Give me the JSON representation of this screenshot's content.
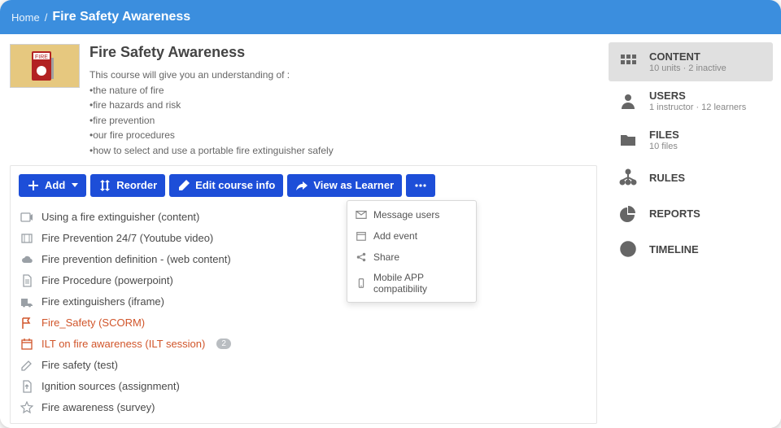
{
  "breadcrumb": {
    "home": "Home",
    "title": "Fire Safety Awareness"
  },
  "course": {
    "title": "Fire Safety Awareness",
    "intro": "This course will give you an understanding of :",
    "bullets": [
      "•the nature of fire",
      "•fire hazards and risk",
      "•fire prevention",
      "•our fire procedures",
      "•how to select and use a portable fire extinguisher safely"
    ]
  },
  "toolbar": {
    "add": "Add",
    "reorder": "Reorder",
    "edit": "Edit course info",
    "view": "View as Learner"
  },
  "more_menu": {
    "message": "Message users",
    "addevent": "Add event",
    "share": "Share",
    "mobile": "Mobile APP compatibility"
  },
  "units": [
    {
      "icon": "video",
      "label": "Using a fire extinguisher (content)",
      "orange": false
    },
    {
      "icon": "film",
      "label": "Fire Prevention 24/7 (Youtube video)",
      "orange": false
    },
    {
      "icon": "cloud",
      "label": "Fire prevention definition - (web content)",
      "orange": false
    },
    {
      "icon": "doc",
      "label": "Fire Procedure (powerpoint)",
      "orange": false
    },
    {
      "icon": "truck",
      "label": "Fire extinguishers (iframe)",
      "orange": false
    },
    {
      "icon": "flag",
      "label": "Fire_Safety (SCORM)",
      "orange": true
    },
    {
      "icon": "cal",
      "label": "ILT on fire awareness (ILT session)",
      "orange": true,
      "badge": "2"
    },
    {
      "icon": "edit",
      "label": "Fire safety (test)",
      "orange": false
    },
    {
      "icon": "docup",
      "label": "Ignition sources (assignment)",
      "orange": false
    },
    {
      "icon": "star",
      "label": "Fire awareness (survey)",
      "orange": false
    }
  ],
  "sidebar": [
    {
      "key": "content",
      "title": "CONTENT",
      "sub": "10 units · 2 inactive",
      "active": true
    },
    {
      "key": "users",
      "title": "USERS",
      "sub": "1 instructor · 12 learners"
    },
    {
      "key": "files",
      "title": "FILES",
      "sub": "10 files"
    },
    {
      "key": "rules",
      "title": "RULES",
      "sub": ""
    },
    {
      "key": "reports",
      "title": "REPORTS",
      "sub": ""
    },
    {
      "key": "timeline",
      "title": "TIMELINE",
      "sub": ""
    }
  ]
}
